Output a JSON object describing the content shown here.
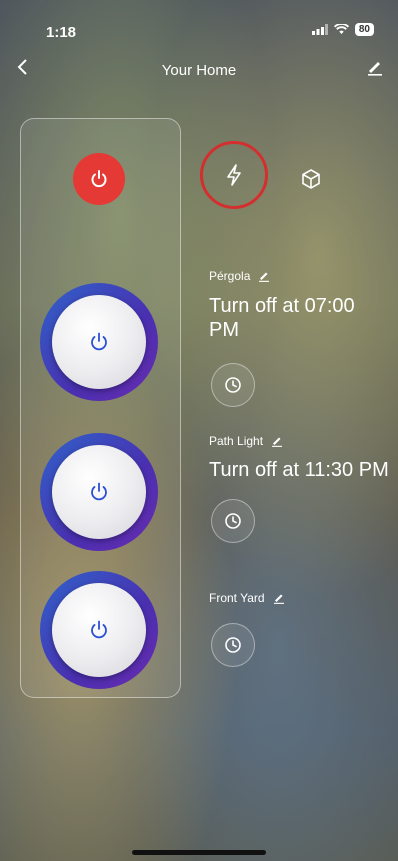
{
  "status_bar": {
    "time": "1:18",
    "battery": "80"
  },
  "header": {
    "title": "Your Home"
  },
  "colors": {
    "power_tab": "#e53935",
    "highlight_ring": "#d32f2f",
    "switch_ring": "#3b4fc4"
  },
  "tabs": [
    {
      "icon": "power-icon",
      "active": true
    },
    {
      "icon": "bolt-icon"
    },
    {
      "icon": "cube-icon"
    }
  ],
  "devices": [
    {
      "name": "Pérgola",
      "schedule": "Turn off at 07:00 PM"
    },
    {
      "name": "Path Light",
      "schedule": "Turn off at 11:30 PM"
    },
    {
      "name": "Front Yard",
      "schedule": ""
    }
  ]
}
